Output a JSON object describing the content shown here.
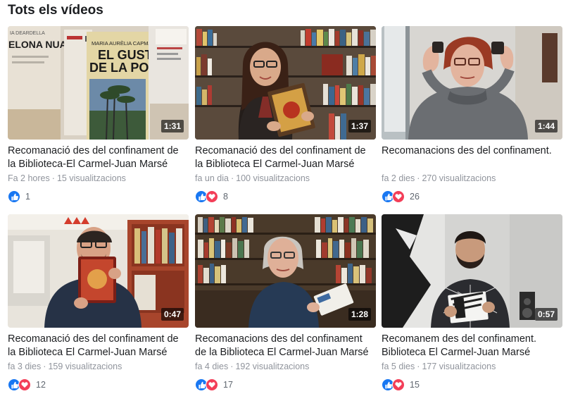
{
  "section": {
    "title": "Tots els vídeos"
  },
  "colors": {
    "like": "#1877f2",
    "love": "#f33e58",
    "meta": "#90949c",
    "text": "#1c1e21"
  },
  "videos": [
    {
      "title": "Recomanació des del confinament de la Biblioteca-El Carmel-Juan Marsé",
      "time_ago": "Fa 2 hores",
      "views": "15 visualitzacions",
      "duration": "1:31",
      "reactions": [
        "like"
      ],
      "count": "1",
      "thumb_text": {
        "left": "ELONA NUA",
        "left_top": "IA DEARDELLA",
        "book_author": "MARIA AURÈLIA CAPMANY",
        "book_title_1": "EL GUST",
        "book_title_2": "DE LA POLS"
      }
    },
    {
      "title": "Recomanació des del confinament de la Biblioteca El Carmel-Juan Marsé",
      "time_ago": "fa un dia",
      "views": "100 visualitzacions",
      "duration": "1:37",
      "reactions": [
        "like",
        "love"
      ],
      "count": "8"
    },
    {
      "title": "Recomanacions des del confinament.",
      "time_ago": "fa 2 dies",
      "views": "270 visualitzacions",
      "duration": "1:44",
      "reactions": [
        "like",
        "love"
      ],
      "count": "26"
    },
    {
      "title": "Recomanació des del confinament de la Biblioteca El Carmel-Juan Marsé",
      "time_ago": "fa 3 dies",
      "views": "159 visualitzacions",
      "duration": "0:47",
      "reactions": [
        "like",
        "love"
      ],
      "count": "12"
    },
    {
      "title": "Recomanacions des del confinament de la Biblioteca El Carmel-Juan Marsé",
      "time_ago": "fa 4 dies",
      "views": "192 visualitzacions",
      "duration": "1:28",
      "reactions": [
        "like",
        "love"
      ],
      "count": "17"
    },
    {
      "title": "Recomanem des del confinament. Biblioteca El Carmel-Juan Marsé",
      "time_ago": "fa 5 dies",
      "views": "177 visualitzacions",
      "duration": "0:57",
      "reactions": [
        "like",
        "love"
      ],
      "count": "15"
    }
  ]
}
